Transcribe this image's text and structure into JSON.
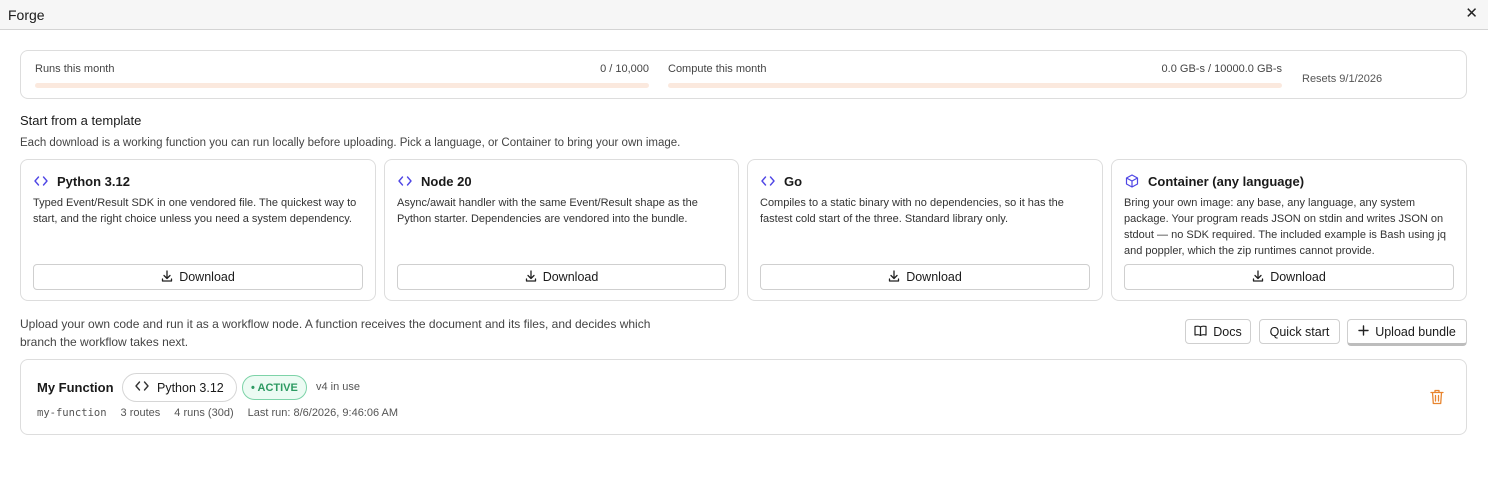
{
  "window": {
    "title": "Forge",
    "close_glyph": "✕"
  },
  "usage": {
    "runs": {
      "label": "Runs this month",
      "value": "0 / 10,000",
      "fraction": 0
    },
    "compute": {
      "label": "Compute this month",
      "value": "0.0 GB-s / 10000.0 GB-s",
      "fraction": 0
    },
    "resets": "Resets 9/1/2026",
    "colors": {
      "track": "#fbe9de",
      "fill": "#f0a77a"
    }
  },
  "templates": {
    "title": "Start from a template",
    "subtitle": "Each download is a working function you can run locally before uploading. Pick a language, or Container to bring your own image.",
    "cards": [
      {
        "icon": "code-icon",
        "name": "Python 3.12",
        "description": "Typed Event/Result SDK in one vendored file. The quickest way to start, and the right choice unless you need a system dependency.",
        "download_label": "Download"
      },
      {
        "icon": "code-icon",
        "name": "Node 20",
        "description": "Async/await handler with the same Event/Result shape as the Python starter. Dependencies are vendored into the bundle.",
        "download_label": "Download"
      },
      {
        "icon": "code-icon",
        "name": "Go",
        "description": "Compiles to a static binary with no dependencies, so it has the fastest cold start of the three. Standard library only.",
        "download_label": "Download"
      },
      {
        "icon": "box-icon",
        "name": "Container (any language)",
        "description": "Bring your own image: any base, any language, any system package. Your program reads JSON on stdin and writes JSON on stdout — no SDK required. The included example is Bash using jq and poppler, which the zip runtimes cannot provide.",
        "download_label": "Download"
      }
    ]
  },
  "upload": {
    "text": "Upload your own code and run it as a workflow node. A function receives the document and its files, and decides which branch the workflow takes next.",
    "docs_label": "Docs",
    "quickstart_label": "Quick start",
    "upload_label": "Upload bundle"
  },
  "function": {
    "name": "My Function",
    "runtime": "Python 3.12",
    "status": "• ACTIVE",
    "version": "v4 in use",
    "slug": "my-function",
    "routes": "3 routes",
    "runs": "4 runs (30d)",
    "last_run": "Last run: 8/6/2026, 9:46:06 AM",
    "colors": {
      "status_green": "#2e9b63",
      "delete_orange": "#e8842e",
      "accent_icon": "#4f46e5"
    }
  }
}
